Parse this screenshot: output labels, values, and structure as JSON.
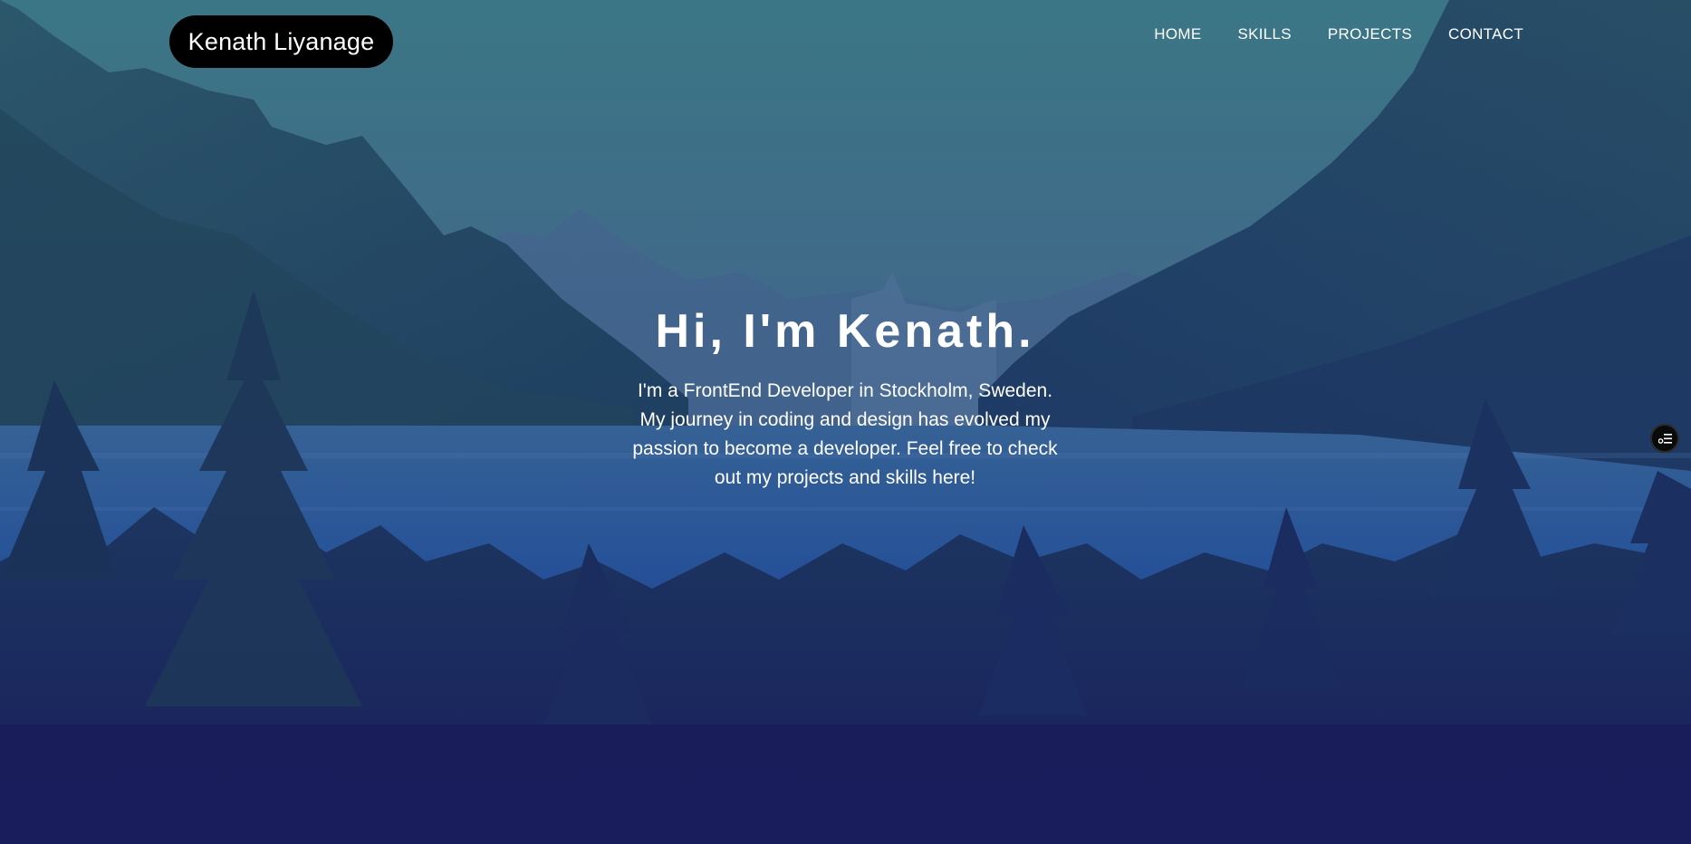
{
  "header": {
    "logo_text": "Kenath Liyanage",
    "nav": [
      {
        "label": "HOME"
      },
      {
        "label": "SKILLS"
      },
      {
        "label": "PROJECTS"
      },
      {
        "label": "CONTACT"
      }
    ]
  },
  "hero": {
    "title": "Hi, I'm Kenath.",
    "intro": "I'm a FrontEnd Developer in Stockholm, Sweden. My journey in coding and design has evolved my passion to become a developer. Feel free to check out my projects and skills here!"
  },
  "floating_menu": {
    "icon": "list-settings-icon"
  },
  "colors": {
    "logo_bg": "#000000",
    "text": "#ffffff",
    "sky": "#3f7d8a",
    "lake": "#2a66a8",
    "forest": "#1b2f66"
  }
}
